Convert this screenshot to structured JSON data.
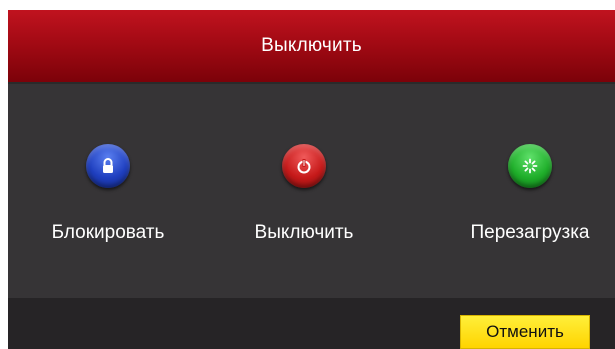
{
  "dialog": {
    "title": "Выключить"
  },
  "actions": [
    {
      "label": "Блокировать",
      "icon": "lock-icon",
      "color": "#1f3fbf"
    },
    {
      "label": "Выключить",
      "icon": "power-icon",
      "color": "#c61a1a"
    },
    {
      "label": "Перезагрузка",
      "icon": "reboot-icon",
      "color": "#1fae2a"
    }
  ],
  "footer": {
    "cancel_label": "Отменить",
    "cancel_color": "#ffd400"
  },
  "colors": {
    "titlebar": "#a30a14",
    "panel": "#363436",
    "footer": "#262426"
  }
}
